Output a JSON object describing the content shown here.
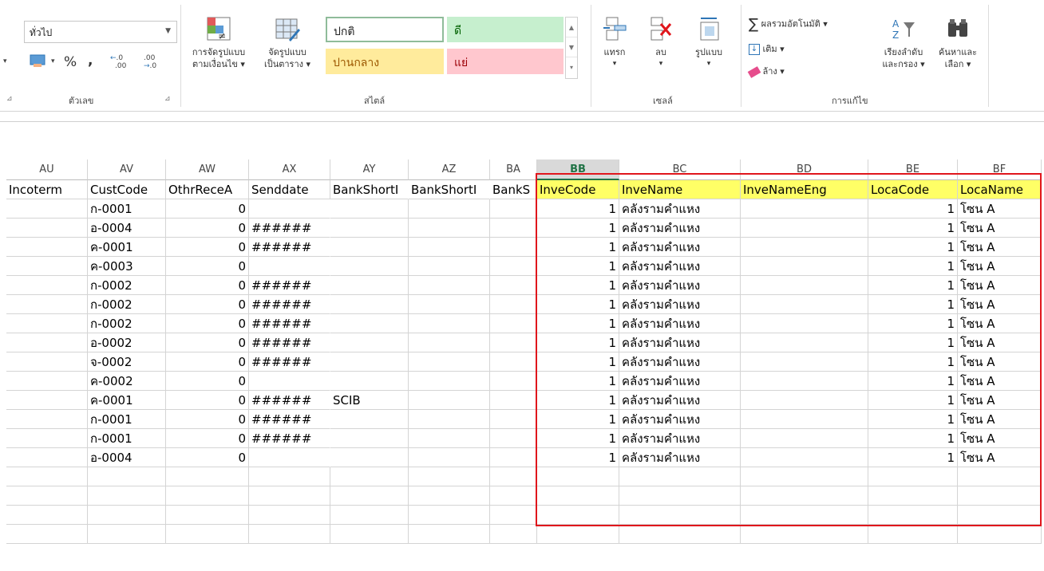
{
  "ribbon": {
    "number_format_value": "ทั่วไป",
    "percent_symbol": "%",
    "comma_symbol": ",",
    "increase_decimal": ".00",
    "decrease_decimal": ".0",
    "group_number_label": "ตัวเลข",
    "conditional_format_label_1": "การจัดรูปแบบ",
    "conditional_format_label_2": "ตามเงื่อนไข ▾",
    "format_table_label_1": "จัดรูปแบบ",
    "format_table_label_2": "เป็นตาราง ▾",
    "styles": {
      "normal": "ปกติ",
      "good": "ดี",
      "neutral": "ปานกลาง",
      "bad": "แย่",
      "group_label": "สไตล์"
    },
    "cells_group": {
      "insert_label": "แทรก",
      "delete_label": "ลบ",
      "format_label": "รูปแบบ",
      "group_label": "เซลล์"
    },
    "editing_group": {
      "autosum_label": "ผลรวมอัตโนมัติ ▾",
      "fill_label": "เติม ▾",
      "clear_label": "ล้าง ▾",
      "sort_filter_label_1": "เรียงลำดับ",
      "sort_filter_label_2": "และกรอง ▾",
      "find_select_label_1": "ค้นหาและ",
      "find_select_label_2": "เลือก ▾",
      "group_label": "การแก้ไข"
    }
  },
  "sheet": {
    "column_letters": [
      "AU",
      "AV",
      "AW",
      "AX",
      "AY",
      "AZ",
      "BA",
      "BB",
      "BC",
      "BD",
      "BE",
      "BF"
    ],
    "active_column": "BB",
    "headers": [
      "Incoterm",
      "CustCode",
      "OthrReceA",
      "Senddate",
      "BankShortI",
      "BankShortI",
      "BankS",
      "InveCode",
      "InveName",
      "InveNameEng",
      "LocaCode",
      "LocaName"
    ],
    "rows": [
      [
        "",
        "ก-0001",
        "0",
        "",
        "",
        "",
        "",
        "1",
        "คลังรามคำแหง",
        "",
        "1",
        "โซน A"
      ],
      [
        "",
        "อ-0004",
        "0",
        "######",
        "",
        "",
        "",
        "1",
        "คลังรามคำแหง",
        "",
        "1",
        "โซน A"
      ],
      [
        "",
        "ค-0001",
        "0",
        "######",
        "",
        "",
        "",
        "1",
        "คลังรามคำแหง",
        "",
        "1",
        "โซน A"
      ],
      [
        "",
        "ค-0003",
        "0",
        "",
        "",
        "",
        "",
        "1",
        "คลังรามคำแหง",
        "",
        "1",
        "โซน A"
      ],
      [
        "",
        "ก-0002",
        "0",
        "######",
        "",
        "",
        "",
        "1",
        "คลังรามคำแหง",
        "",
        "1",
        "โซน A"
      ],
      [
        "",
        "ก-0002",
        "0",
        "######",
        "",
        "",
        "",
        "1",
        "คลังรามคำแหง",
        "",
        "1",
        "โซน A"
      ],
      [
        "",
        "ก-0002",
        "0",
        "######",
        "",
        "",
        "",
        "1",
        "คลังรามคำแหง",
        "",
        "1",
        "โซน A"
      ],
      [
        "",
        "อ-0002",
        "0",
        "######",
        "",
        "",
        "",
        "1",
        "คลังรามคำแหง",
        "",
        "1",
        "โซน A"
      ],
      [
        "",
        "จ-0002",
        "0",
        "######",
        "",
        "",
        "",
        "1",
        "คลังรามคำแหง",
        "",
        "1",
        "โซน A"
      ],
      [
        "",
        "ค-0002",
        "0",
        "",
        "",
        "",
        "",
        "1",
        "คลังรามคำแหง",
        "",
        "1",
        "โซน A"
      ],
      [
        "",
        "ค-0001",
        "0",
        "######",
        "SCIB",
        "",
        "",
        "1",
        "คลังรามคำแหง",
        "",
        "1",
        "โซน A"
      ],
      [
        "",
        "ก-0001",
        "0",
        "######",
        "",
        "",
        "",
        "1",
        "คลังรามคำแหง",
        "",
        "1",
        "โซน A"
      ],
      [
        "",
        "ก-0001",
        "0",
        "######",
        "",
        "",
        "",
        "1",
        "คลังรามคำแหง",
        "",
        "1",
        "โซน A"
      ],
      [
        "",
        "อ-0004",
        "0",
        "",
        "",
        "",
        "",
        "1",
        "คลังรามคำแหง",
        "",
        "1",
        "โซน A"
      ]
    ]
  },
  "colors": {
    "header_highlight": "#ffff66",
    "selection_box": "#e0161c",
    "good_style_bg": "#c6efce",
    "neutral_style_bg": "#ffeb9c",
    "bad_style_bg": "#ffc7ce"
  }
}
